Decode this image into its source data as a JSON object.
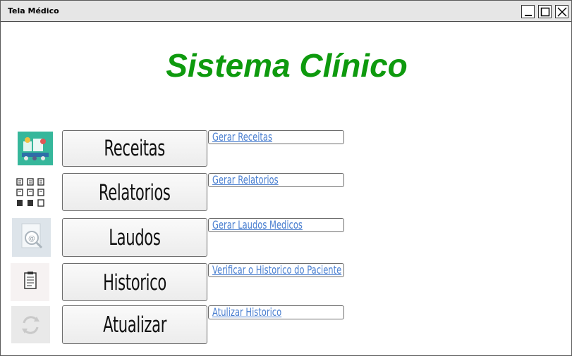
{
  "window": {
    "title": "Tela Médico",
    "controls": [
      "minimize-icon",
      "maximize-icon",
      "close-icon"
    ]
  },
  "heading": "Sistema Clínico",
  "colors": {
    "heading": "#0e9a0e",
    "link": "#4a7fd0"
  },
  "items": [
    {
      "icon": "prescription-illustration-icon",
      "button": "Receitas",
      "link": "Gerar Receitas"
    },
    {
      "icon": "document-grid-icon",
      "button": "Relatorios",
      "link": "Gerar Relatorios"
    },
    {
      "icon": "search-document-icon",
      "button": "Laudos",
      "link": "Gerar Laudos Medicos"
    },
    {
      "icon": "clipboard-icon",
      "button": "Historico",
      "link": "Verificar o Historico do Paciente"
    },
    {
      "icon": "refresh-icon",
      "button": "Atualizar",
      "link": "Atulizar Historico"
    }
  ]
}
